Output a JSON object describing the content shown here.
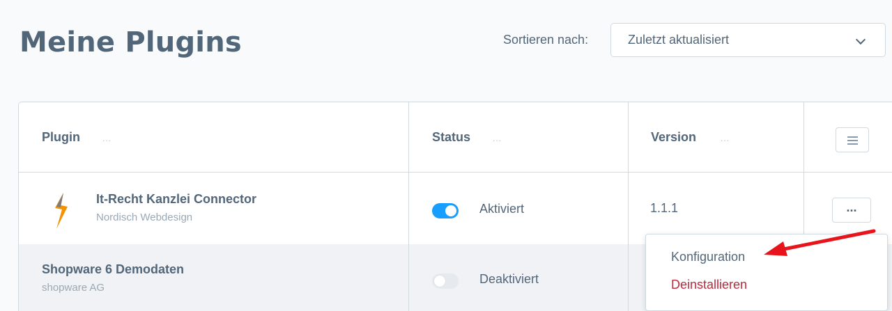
{
  "page": {
    "title": "Meine Plugins"
  },
  "sort": {
    "label": "Sortieren nach:",
    "value": "Zuletzt aktualisiert"
  },
  "table": {
    "columns": [
      {
        "label": "Plugin",
        "dots": "..."
      },
      {
        "label": "Status",
        "dots": "..."
      },
      {
        "label": "Version",
        "dots": "..."
      }
    ],
    "rows": [
      {
        "name": "It-Recht Kanzlei Connector",
        "vendor": "Nordisch Webdesign",
        "active": true,
        "status": "Aktiviert",
        "version": "1.1.1",
        "actions": "..."
      },
      {
        "name": "Shopware 6 Demodaten",
        "vendor": "shopware AG",
        "active": false,
        "status": "Deaktiviert"
      }
    ]
  },
  "context_menu": {
    "items": [
      {
        "label": "Konfiguration"
      },
      {
        "label": "Deinstallieren"
      }
    ]
  },
  "icons": {
    "settings": "list-settings-icon",
    "logo": "itrecht-logo-icon",
    "annotation": "red-arrow-annotation"
  },
  "colors": {
    "accent": "#189eff",
    "danger": "#c0283c",
    "text": "#52667a",
    "arrow": "#e8141b"
  }
}
